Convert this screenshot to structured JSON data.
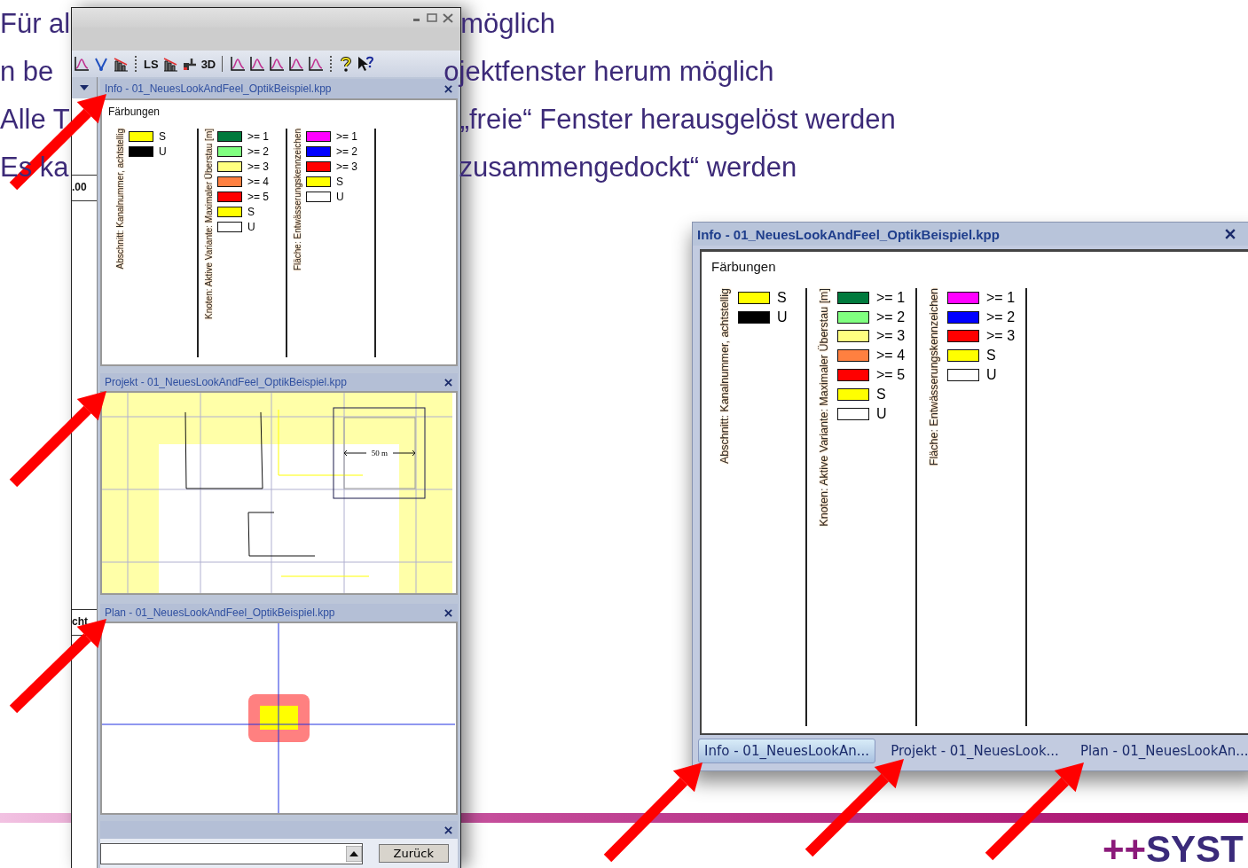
{
  "slide": {
    "bullets": [
      {
        "left": "Für al",
        "right": "möglich"
      },
      {
        "left": "n be",
        "right": "ojektfenster herum möglich"
      },
      {
        "left": "Alle T",
        "right": "„freie“ Fenster herausgelöst werden"
      },
      {
        "left": "Es ka",
        "right": "zusammengedockt“ werden"
      }
    ],
    "logo": {
      "mark": "++",
      "text": "SYST"
    }
  },
  "docked_window": {
    "toolbar_labels": [
      "LS",
      "3D"
    ],
    "side_strip": [
      ".00",
      "cht"
    ],
    "panels": [
      {
        "kind": "legend",
        "title": "Info - 01_NeuesLookAndFeel_OptikBeispiel.kpp",
        "legend": {
          "heading": "Färbungen",
          "groups": [
            {
              "label": "Abschnitt: Kanalnummer, achtstellig",
              "items": [
                {
                  "color": "#ffff00",
                  "label": "S"
                },
                {
                  "color": "#000000",
                  "label": "U"
                }
              ]
            },
            {
              "label": "Knoten: Aktive Variante: Maximaler Überstau [m]",
              "items": [
                {
                  "color": "#007a3d",
                  "label": ">= 1"
                },
                {
                  "color": "#80ff80",
                  "label": ">= 2"
                },
                {
                  "color": "#ffff80",
                  "label": ">= 3"
                },
                {
                  "color": "#ff8040",
                  "label": ">= 4"
                },
                {
                  "color": "#ff0000",
                  "label": ">= 5"
                },
                {
                  "color": "#ffff00",
                  "label": "S"
                },
                {
                  "color": "#ffffff",
                  "label": "U"
                }
              ]
            },
            {
              "label": "Fläche: Entwässerungskennzeichen",
              "items": [
                {
                  "color": "#ff00ff",
                  "label": ">= 1"
                },
                {
                  "color": "#0000ff",
                  "label": ">= 2"
                },
                {
                  "color": "#ff0000",
                  "label": ">= 3"
                },
                {
                  "color": "#ffff00",
                  "label": "S"
                },
                {
                  "color": "#ffffff",
                  "label": "U"
                }
              ]
            }
          ]
        }
      },
      {
        "kind": "project_map",
        "title": "Projekt - 01_NeuesLookAndFeel_OptikBeispiel.kpp",
        "scale_label": "50 m"
      },
      {
        "kind": "plan_map",
        "title": "Plan - 01_NeuesLookAndFeel_OptikBeispiel.kpp"
      },
      {
        "kind": "console",
        "button": "Zurück"
      }
    ]
  },
  "floating_window": {
    "title": "Info - 01_NeuesLookAndFeel_OptikBeispiel.kpp",
    "legend": {
      "heading": "Färbungen",
      "groups": [
        {
          "label": "Abschnitt: Kanalnummer, achtstellig",
          "items": [
            {
              "color": "#ffff00",
              "label": "S"
            },
            {
              "color": "#000000",
              "label": "U"
            }
          ]
        },
        {
          "label": "Knoten: Aktive Variante: Maximaler Überstau [m]",
          "items": [
            {
              "color": "#007a3d",
              "label": ">= 1"
            },
            {
              "color": "#80ff80",
              "label": ">= 2"
            },
            {
              "color": "#ffff80",
              "label": ">= 3"
            },
            {
              "color": "#ff8040",
              "label": ">= 4"
            },
            {
              "color": "#ff0000",
              "label": ">= 5"
            },
            {
              "color": "#ffff00",
              "label": "S"
            },
            {
              "color": "#ffffff",
              "label": "U"
            }
          ]
        },
        {
          "label": "Fläche: Entwässerungskennzeichen",
          "items": [
            {
              "color": "#ff00ff",
              "label": ">= 1"
            },
            {
              "color": "#0000ff",
              "label": ">= 2"
            },
            {
              "color": "#ff0000",
              "label": ">= 3"
            },
            {
              "color": "#ffff00",
              "label": "S"
            },
            {
              "color": "#ffffff",
              "label": "U"
            }
          ]
        }
      ]
    },
    "tabs": [
      {
        "label": "Info - 01_NeuesLookAn...",
        "selected": true
      },
      {
        "label": "Projekt - 01_NeuesLook...",
        "selected": false
      },
      {
        "label": "Plan - 01_NeuesLookAn...",
        "selected": false
      }
    ]
  }
}
